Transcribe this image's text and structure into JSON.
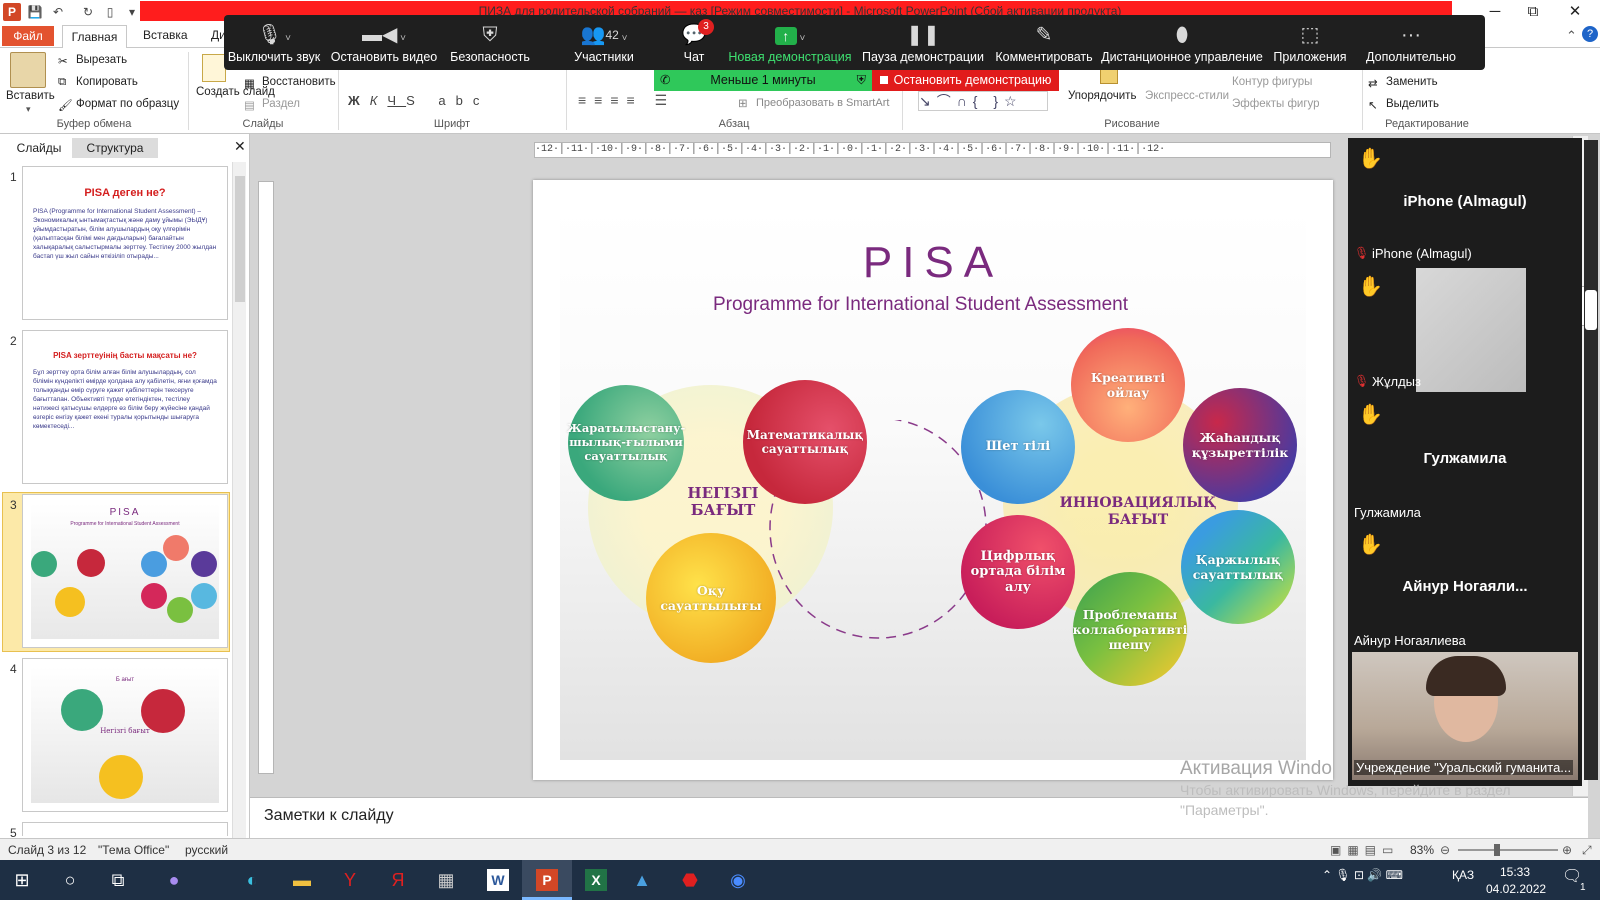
{
  "window": {
    "title": "ПИЗА для родительской собраний — каз [Режим совместимости] - Microsoft PowerPoint (Сбой активации продукта)",
    "minimize": "─",
    "maximize": "⧉",
    "close": "✕"
  },
  "ribbon_tabs": {
    "file": "Файл",
    "home": "Главная",
    "insert": "Вставка",
    "design_partial": "Ди"
  },
  "ribbon": {
    "paste": "Вставить",
    "cut": "Вырезать",
    "copy": "Копировать",
    "format_painter": "Формат по образцу",
    "clipboard_group": "Буфер обмена",
    "new_slide": "Создать слайд",
    "restore": "Восстановить",
    "section": "Раздел",
    "slides_group": "Слайды",
    "font_group": "Шрифт",
    "paragraph_group": "Абзац",
    "smartart": "Преобразовать в SmartArt",
    "arrange": "Упорядочить",
    "quick_styles": "Экспресс-стили",
    "shape_outline": "Контур фигуры",
    "shape_effects": "Эффекты фигур",
    "drawing_group": "Рисование",
    "replace": "Заменить",
    "select": "Выделить",
    "editing_group": "Редактирование"
  },
  "zoom_toolbar": {
    "mute": "Выключить звук",
    "stop_video": "Остановить видео",
    "security": "Безопасность",
    "participants": "Участники",
    "participants_count": "42",
    "chat": "Чат",
    "chat_badge": "3",
    "new_share": "Новая демонстрация",
    "pause_share": "Пауза демонстрации",
    "annotate": "Комментировать",
    "remote_control": "Дистанционное управление",
    "apps": "Приложения",
    "more": "Дополнительно",
    "timer": "Меньше 1 минуты",
    "stop_share": "Остановить демонстрацию"
  },
  "left_pane": {
    "tab_slides": "Слайды",
    "tab_outline": "Структура",
    "thumbs": [
      {
        "num": "1",
        "title": "PISA деген не?",
        "body": "PISA (Programme for International Student Assessment) – Экономикалық ынтымақтастық және даму ұйымы (ЭЫДҰ) ұйымдастыратын, білім алушылардың оқу үлгерімін (қалыптасқан білімі мен дағдыларын) бағалайтын халықаралық салыстырмалы зерттеу. Тестілеу 2000 жылдан бастап үш жыл сайын өткізіліп отырады..."
      },
      {
        "num": "2",
        "title": "PISA зерттеуінің басты мақсаты не?",
        "body": "Бұл зерттеу орта білім алған білім алушылардың, сол білімін күнделікті өмірде қолдана алу қабілетін, яғни қоғамда толыққанды өмір сүруге қажет қабілеттерін тексеруге бағыттапан. Объективті түрде өтетіндіктен, тестілеу нәтижесі қатысушы елдерге өз білім беру жүйесіне қандай өзгеріс енгізу қажет екені туралы қорытынды шығаруга көмектеседі..."
      },
      {
        "num": "3",
        "title": "PISA",
        "subtitle": "Programme for International Student Assessment"
      },
      {
        "num": "4",
        "center": "Негізгі бағыт",
        "top": "Б ағыт"
      },
      {
        "num": "5"
      }
    ]
  },
  "slide": {
    "title": "PISA",
    "subtitle": "Programme for International Student Assessment",
    "left_label": "НЕГІЗГІ\nБАҒЫТ",
    "right_label": "ИННОВАЦИЯЛЫҚ\nБАҒЫТ",
    "circles": [
      {
        "label": "Жаратылыстану-шылық-ғылыми сауаттылық",
        "color1": "#3aa87c",
        "color2": "#8fd0a0"
      },
      {
        "label": "Математикалық сауаттылық",
        "color1": "#c6283c",
        "color2": "#e5506a"
      },
      {
        "label": "Оқу сауаттылығы",
        "color1": "#f0a820",
        "color2": "#ffe24a"
      },
      {
        "label": "Креативті ойлау",
        "color1": "#f06a5a",
        "color2": "#ffb07a"
      },
      {
        "label": "Шет тілі",
        "color1": "#3a8fd8",
        "color2": "#7ac8ea"
      },
      {
        "label": "Жаһандық құзыреттілік",
        "color1": "#4a3aa0",
        "color2": "#c8284a"
      },
      {
        "label": "Цифрлық ортада білім алу",
        "color1": "#c81e5a",
        "color2": "#f0506a"
      },
      {
        "label": "Қаржылық сауаттылық",
        "color1": "#3a9ce0",
        "color2": "#c8e040"
      },
      {
        "label": "Проблеманы коллаборативті шешу",
        "color1": "#58b040",
        "color2": "#f0c830"
      }
    ]
  },
  "participants": {
    "p1_big": "iPhone (Almagul)",
    "p1_small": "iPhone (Almagul)",
    "p2_small": "Жұлдыз",
    "p3_big": "Гулжамила",
    "p3_small": "Гулжамила",
    "p4_big": "Айнур  Ногаяли...",
    "p4_small": "Айнур Ногаялиева",
    "p5_small": "Учреждение \"Уральский гуманита..."
  },
  "notes": {
    "placeholder": "Заметки к слайду"
  },
  "watermark": {
    "line1": "Активация Windo",
    "line2": "Чтобы активировать Windows, перейдите в раздел",
    "line3": "\"Параметры\"."
  },
  "status": {
    "slide_of": "Слайд 3 из 12",
    "theme": "\"Тема Office\"",
    "language": "русский",
    "zoom": "83%"
  },
  "taskbar": {
    "lang": "ҚАЗ",
    "time": "15:33",
    "date": "04.02.2022",
    "notif": "1"
  },
  "ruler": {
    "h": "·12·│·11·│·10·│·9·│·8·│·7·│·6·│·5·│·4·│·3·│·2·│·1·│·0·│·1·│·2·│·3·│·4·│·5·│·6·│·7·│·8·│·9·│·10·│·11·│·12·"
  },
  "colors": {
    "ppt_orange": "#d24726",
    "zoom_green": "#2fc85a",
    "stop_red": "#e11b1b",
    "title_purple": "#7a2a7e"
  }
}
